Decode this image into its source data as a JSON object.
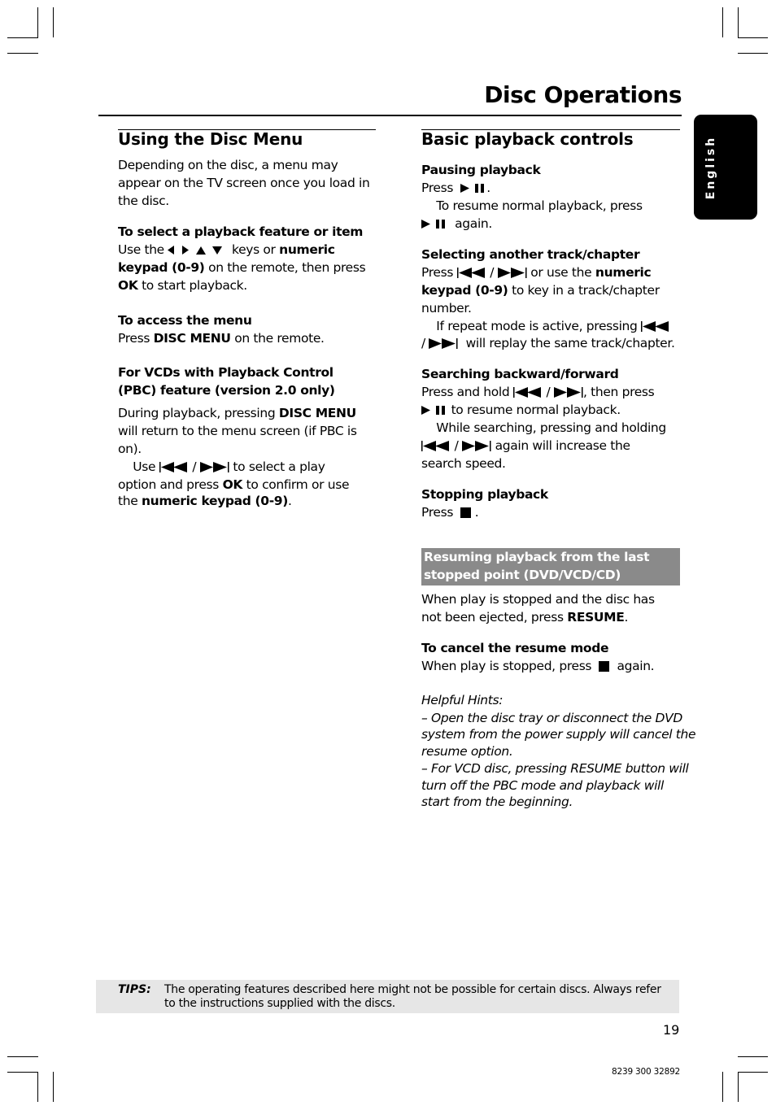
{
  "page": {
    "title": "Disc Operations",
    "language_tab": "English",
    "page_number": "19",
    "code": "8239 300 32892"
  },
  "left": {
    "heading": "Using the Disc Menu",
    "lines": [
      [
        {
          "t": "Depending on the disc, a menu may"
        }
      ],
      [
        {
          "t": "appear on the TV screen once you load in"
        }
      ],
      [
        {
          "t": "the disc."
        }
      ],
      [
        {
          "t": "To select a playback feature or item",
          "b": true
        }
      ],
      [
        {
          "t": "Use the "
        },
        {
          "icon": "arrow-keys"
        },
        {
          "t": " keys or "
        },
        {
          "t": "numeric",
          "b": true
        }
      ],
      [
        {
          "t": "keypad (0-9)",
          "b": true
        },
        {
          "t": " on the remote, then press"
        }
      ],
      [
        {
          "t": "OK",
          "b": true
        },
        {
          "t": " to start playback."
        }
      ],
      [
        {
          "t": "To access the menu",
          "b": true
        }
      ],
      [
        {
          "t": "Press "
        },
        {
          "t": "DISC MENU",
          "b": true
        },
        {
          "t": " on the remote."
        }
      ],
      [
        {
          "t": "For VCDs with Playback Control",
          "b": true
        }
      ],
      [
        {
          "t": "(PBC) feature (version 2.0 only)",
          "b": true
        }
      ],
      [
        {
          "t": "During playback, pressing "
        },
        {
          "t": "DISC MENU",
          "b": true
        }
      ],
      [
        {
          "t": "will return to the menu screen (if PBC is"
        }
      ],
      [
        {
          "t": "on)."
        }
      ],
      [
        {
          "t": "    Use "
        },
        {
          "icon": "prev"
        },
        {
          "t": " / "
        },
        {
          "icon": "next"
        },
        {
          "t": " to select a play"
        }
      ],
      [
        {
          "t": "option and press "
        },
        {
          "t": "OK",
          "b": true
        },
        {
          "t": " to confirm or use"
        }
      ],
      [
        {
          "t": "the "
        },
        {
          "t": "numeric keypad (0-9)",
          "b": true
        },
        {
          "t": "."
        }
      ]
    ]
  },
  "right": {
    "heading": "Basic playback controls",
    "lines": [
      [
        {
          "t": "Pausing playback",
          "b": true
        }
      ],
      [
        {
          "t": "Press  "
        },
        {
          "icon": "play-pause"
        },
        {
          "t": "."
        }
      ],
      [
        {
          "t": "    To resume normal playback, press"
        }
      ],
      [
        {
          "t": " "
        },
        {
          "icon": "play-pause"
        },
        {
          "t": "  again."
        }
      ],
      [
        {
          "t": "Selecting another track/chapter",
          "b": true
        }
      ],
      [
        {
          "t": "Press "
        },
        {
          "icon": "prev"
        },
        {
          "t": " / "
        },
        {
          "icon": "next"
        },
        {
          "t": " or use the "
        },
        {
          "t": "numeric",
          "b": true
        }
      ],
      [
        {
          "t": "keypad (0-9)",
          "b": true
        },
        {
          "t": " to key in a track/chapter"
        }
      ],
      [
        {
          "t": "number."
        }
      ],
      [
        {
          "t": "    If repeat mode is active, pressing "
        },
        {
          "icon": "prev"
        }
      ],
      [
        {
          "t": "/ "
        },
        {
          "icon": "next"
        },
        {
          "t": "  will replay the same track/chapter."
        }
      ],
      [
        {
          "t": "Searching backward/forward",
          "b": true
        }
      ],
      [
        {
          "t": "Press and hold "
        },
        {
          "icon": "prev"
        },
        {
          "t": " / "
        },
        {
          "icon": "next"
        },
        {
          "t": ", then press"
        }
      ],
      [
        {
          "t": " "
        },
        {
          "icon": "play-pause"
        },
        {
          "t": " to resume normal playback."
        }
      ],
      [
        {
          "t": "    While searching, pressing and holding"
        }
      ],
      [
        {
          "icon": "prev"
        },
        {
          "t": " / "
        },
        {
          "icon": "next"
        },
        {
          "t": " again will increase the"
        }
      ],
      [
        {
          "t": "search speed."
        }
      ],
      [
        {
          "t": "Stopping playback",
          "b": true
        }
      ],
      [
        {
          "t": "Press  "
        },
        {
          "icon": "stop"
        },
        {
          "t": " ."
        }
      ]
    ],
    "resume_box": {
      "lines": [
        "Resuming playback from the last",
        "stopped point (DVD/VCD/CD)"
      ]
    },
    "resume_lines": [
      [
        {
          "t": "When play is stopped and the disc has"
        }
      ],
      [
        {
          "t": "not been ejected, press "
        },
        {
          "t": "RESUME",
          "b": true
        },
        {
          "t": "."
        }
      ],
      [
        {
          "t": "To cancel the resume mode",
          "b": true
        }
      ],
      [
        {
          "t": "When play is stopped, press  "
        },
        {
          "icon": "stop"
        },
        {
          "t": "  again."
        }
      ]
    ],
    "hints": [
      "Helpful Hints:",
      "–  Open the disc tray or disconnect the DVD",
      "system from the power supply will cancel the",
      "resume option.",
      "–  For VCD disc, pressing RESUME button will",
      "turn off the PBC mode and playback will",
      "start from the beginning."
    ]
  },
  "tips": {
    "label": "TIPS:",
    "lines": [
      "The operating features described here might not be possible for certain discs.  Always refer",
      "to the instructions supplied with the discs."
    ]
  },
  "icons": {
    "arrow-keys": "left-right-up-down-arrow-keys-icon",
    "prev": "skip-previous-icon",
    "next": "skip-next-icon",
    "play-pause": "play-pause-icon",
    "stop": "stop-icon"
  }
}
